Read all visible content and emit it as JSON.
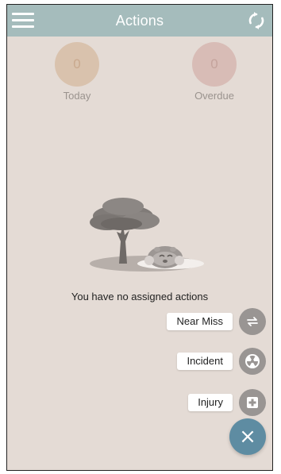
{
  "header": {
    "title": "Actions",
    "menu_icon": "hamburger-menu-icon",
    "refresh_icon": "refresh-icon",
    "color": "#a5bcbc"
  },
  "stats": [
    {
      "value": "0",
      "label": "Today",
      "color": "#d9c2ad"
    },
    {
      "value": "0",
      "label": "Overdue",
      "color": "#d8bcb6"
    }
  ],
  "empty_state": {
    "message": "You have no assigned actions",
    "illustration": "tree-and-sleeping-creature-illustration"
  },
  "fab_menu": {
    "items": [
      {
        "label": "Near Miss",
        "icon": "swap-arrows-icon"
      },
      {
        "label": "Incident",
        "icon": "radiation-icon"
      },
      {
        "label": "Injury",
        "icon": "medical-cross-icon"
      }
    ],
    "close_icon": "close-icon",
    "fab_color": "#5e8ca2"
  }
}
